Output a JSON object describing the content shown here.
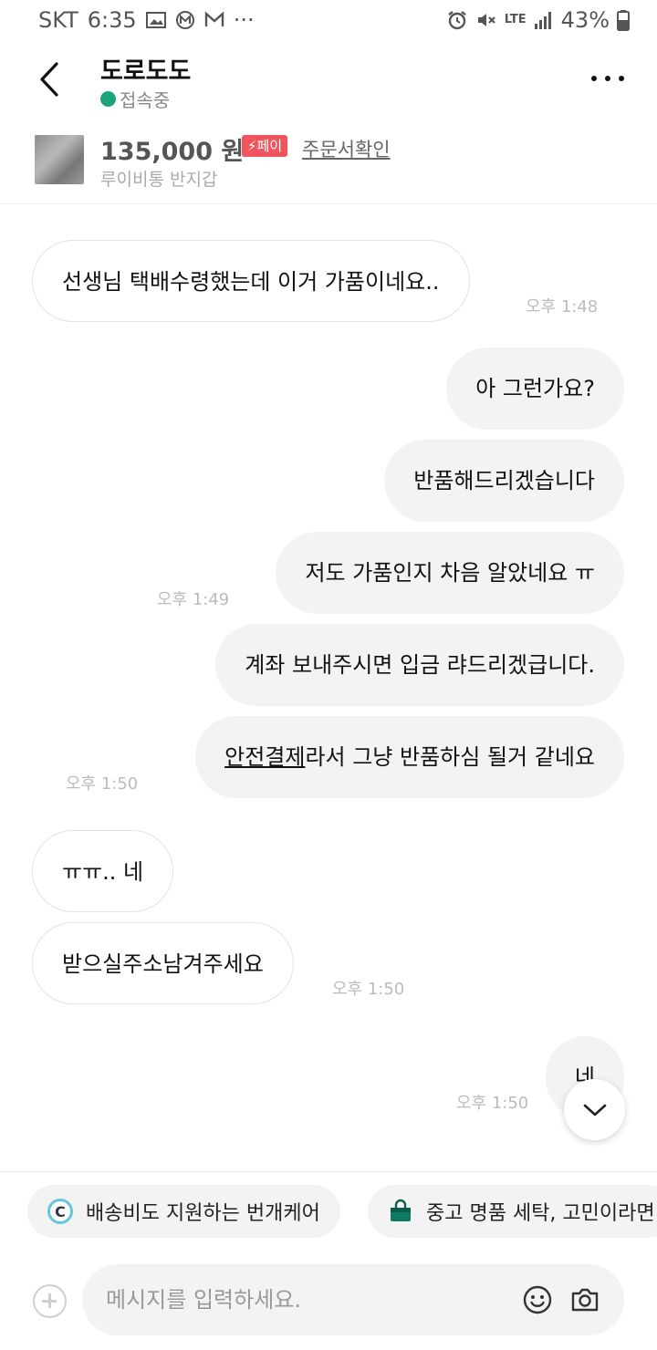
{
  "status_bar": {
    "carrier": "SKT",
    "time": "6:35",
    "network": "LTE",
    "battery": "43%"
  },
  "header": {
    "name": "도로도도",
    "presence": "접속중"
  },
  "product": {
    "price": "135,000 원",
    "pay_badge": "페이",
    "order_link": "주문서확인",
    "name": "루이비통 반지갑"
  },
  "messages": [
    {
      "text": "선생님 택배수령했는데 이거 가품이네요..",
      "side": "in"
    },
    {
      "time": "오후 1:48"
    },
    {
      "text": "아 그런가요?",
      "side": "out"
    },
    {
      "text": "반품해드리겠습니다",
      "side": "out"
    },
    {
      "text": "저도 가품인지 차음 알았네요 ㅠ",
      "side": "out"
    },
    {
      "time": "오후 1:49"
    },
    {
      "text": "계좌 보내주시면 입금 랴드리겠급니다.",
      "side": "out"
    },
    {
      "underlined": "안전결제",
      "text": "라서 그냥 반품하심 될거 같네요",
      "side": "out"
    },
    {
      "time": "오후 1:50"
    },
    {
      "text": "ㅠㅠ..  네",
      "side": "in"
    },
    {
      "text": "받으실주소남겨주세요",
      "side": "in"
    },
    {
      "time": "오후 1:50"
    },
    {
      "text": "네",
      "side": "out"
    },
    {
      "time": "오후 1:50"
    }
  ],
  "suggestions": [
    {
      "icon_letter": "C",
      "label": "배송비도 지원하는 번개케어"
    },
    {
      "label": "중고 명품 세탁, 고민이라면"
    }
  ],
  "input": {
    "placeholder": "메시지를 입력하세요."
  },
  "icons": {
    "back": "chevron-left-icon",
    "more": "more-dots-icon",
    "scroll": "chevron-down-icon",
    "add": "plus-circle-icon",
    "emoji": "emoji-icon",
    "camera": "camera-icon",
    "bag": "bag-icon"
  },
  "colors": {
    "online_dot": "#1ba37b",
    "pay_badge": "#f0555d",
    "bubble_out": "#f3f3f3",
    "bubble_in_border": "#e3e3e3"
  }
}
